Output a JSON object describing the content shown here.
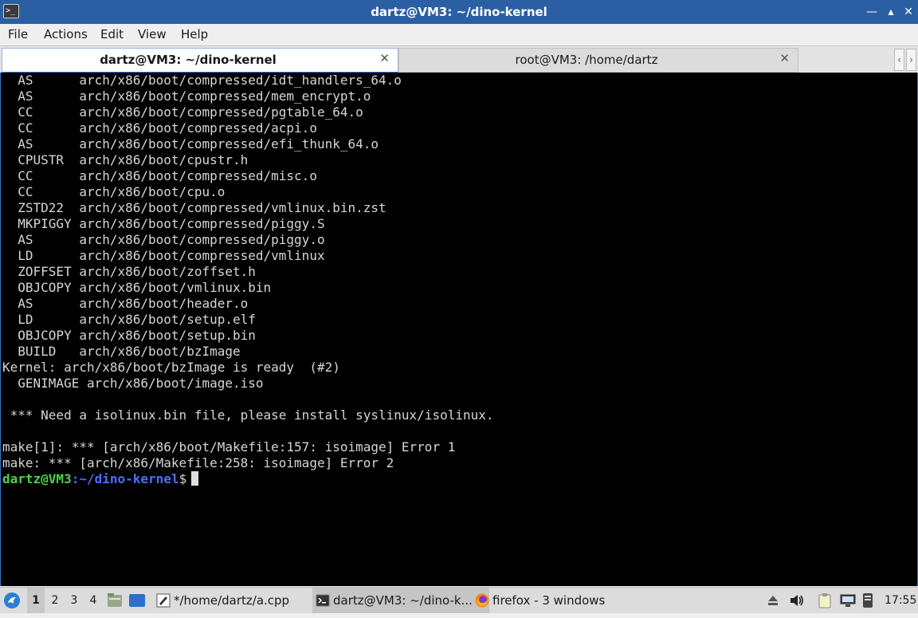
{
  "window": {
    "title": "dartz@VM3: ~/dino-kernel",
    "app_icon": "terminal-icon",
    "controls": [
      "minimize",
      "maximize",
      "close"
    ]
  },
  "menu": [
    "File",
    "Actions",
    "Edit",
    "View",
    "Help"
  ],
  "tabs": [
    {
      "label": "dartz@VM3: ~/dino-kernel",
      "active": true
    },
    {
      "label": "root@VM3: /home/dartz",
      "active": false
    }
  ],
  "terminal": {
    "lines": [
      "  AS      arch/x86/boot/compressed/idt_handlers_64.o",
      "  AS      arch/x86/boot/compressed/mem_encrypt.o",
      "  CC      arch/x86/boot/compressed/pgtable_64.o",
      "  CC      arch/x86/boot/compressed/acpi.o",
      "  AS      arch/x86/boot/compressed/efi_thunk_64.o",
      "  CPUSTR  arch/x86/boot/cpustr.h",
      "  CC      arch/x86/boot/compressed/misc.o",
      "  CC      arch/x86/boot/cpu.o",
      "  ZSTD22  arch/x86/boot/compressed/vmlinux.bin.zst",
      "  MKPIGGY arch/x86/boot/compressed/piggy.S",
      "  AS      arch/x86/boot/compressed/piggy.o",
      "  LD      arch/x86/boot/compressed/vmlinux",
      "  ZOFFSET arch/x86/boot/zoffset.h",
      "  OBJCOPY arch/x86/boot/vmlinux.bin",
      "  AS      arch/x86/boot/header.o",
      "  LD      arch/x86/boot/setup.elf",
      "  OBJCOPY arch/x86/boot/setup.bin",
      "  BUILD   arch/x86/boot/bzImage",
      "Kernel: arch/x86/boot/bzImage is ready  (#2)",
      "  GENIMAGE arch/x86/boot/image.iso",
      "",
      " *** Need a isolinux.bin file, please install syslinux/isolinux.",
      "",
      "make[1]: *** [arch/x86/boot/Makefile:157: isoimage] Error 1",
      "make: *** [arch/x86/Makefile:258: isoimage] Error 2"
    ],
    "prompt": {
      "user_host": "dartz@VM3",
      "separator": ":",
      "path": "~/dino-kernel",
      "symbol": "$"
    },
    "colors": {
      "background": "#000000",
      "text": "#d6d6d6",
      "user": "#4bd34a",
      "path": "#4a6fff"
    }
  },
  "taskbar": {
    "menu_icon": "lxqt-menu-icon",
    "workspaces": [
      "1",
      "2",
      "3",
      "4"
    ],
    "active_workspace": "1",
    "launchers": [
      "file-manager-icon",
      "show-desktop-icon"
    ],
    "tasks": [
      {
        "label": "*/home/dartz/a.cpp",
        "icon": "text-editor-icon"
      },
      {
        "label": "dartz@VM3: ~/dino-k...",
        "icon": "terminal-icon",
        "active": true
      },
      {
        "label": "firefox - 3 windows",
        "icon": "firefox-icon"
      }
    ],
    "tray": [
      "eject-icon",
      "volume-icon",
      "clipboard-icon",
      "network-icon",
      "keyboard-icon"
    ],
    "clock": "17:55"
  }
}
